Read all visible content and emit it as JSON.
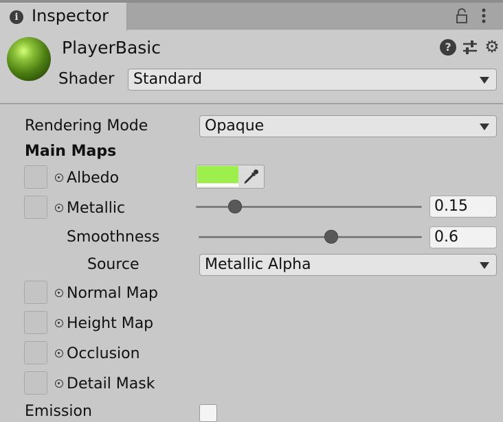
{
  "tab": {
    "title": "Inspector",
    "info_icon": "i"
  },
  "header": {
    "title": "PlayerBasic",
    "shader_label": "Shader",
    "shader_value": "Standard",
    "help_icon": "?",
    "gear_icon": "⚙"
  },
  "props": {
    "rendering_mode_label": "Rendering Mode",
    "rendering_mode_value": "Opaque",
    "main_maps_label": "Main Maps",
    "albedo_label": "Albedo",
    "albedo_color": "#9df04b",
    "metallic_label": "Metallic",
    "metallic_value": "0.15",
    "smoothness_label": "Smoothness",
    "smoothness_value": "0.6",
    "source_label": "Source",
    "source_value": "Metallic Alpha",
    "normal_map_label": "Normal Map",
    "height_map_label": "Height Map",
    "occlusion_label": "Occlusion",
    "detail_mask_label": "Detail Mask",
    "emission_label": "Emission"
  },
  "colors": {
    "material_preview": "#5a8f1a",
    "albedo": "#9df04b"
  }
}
